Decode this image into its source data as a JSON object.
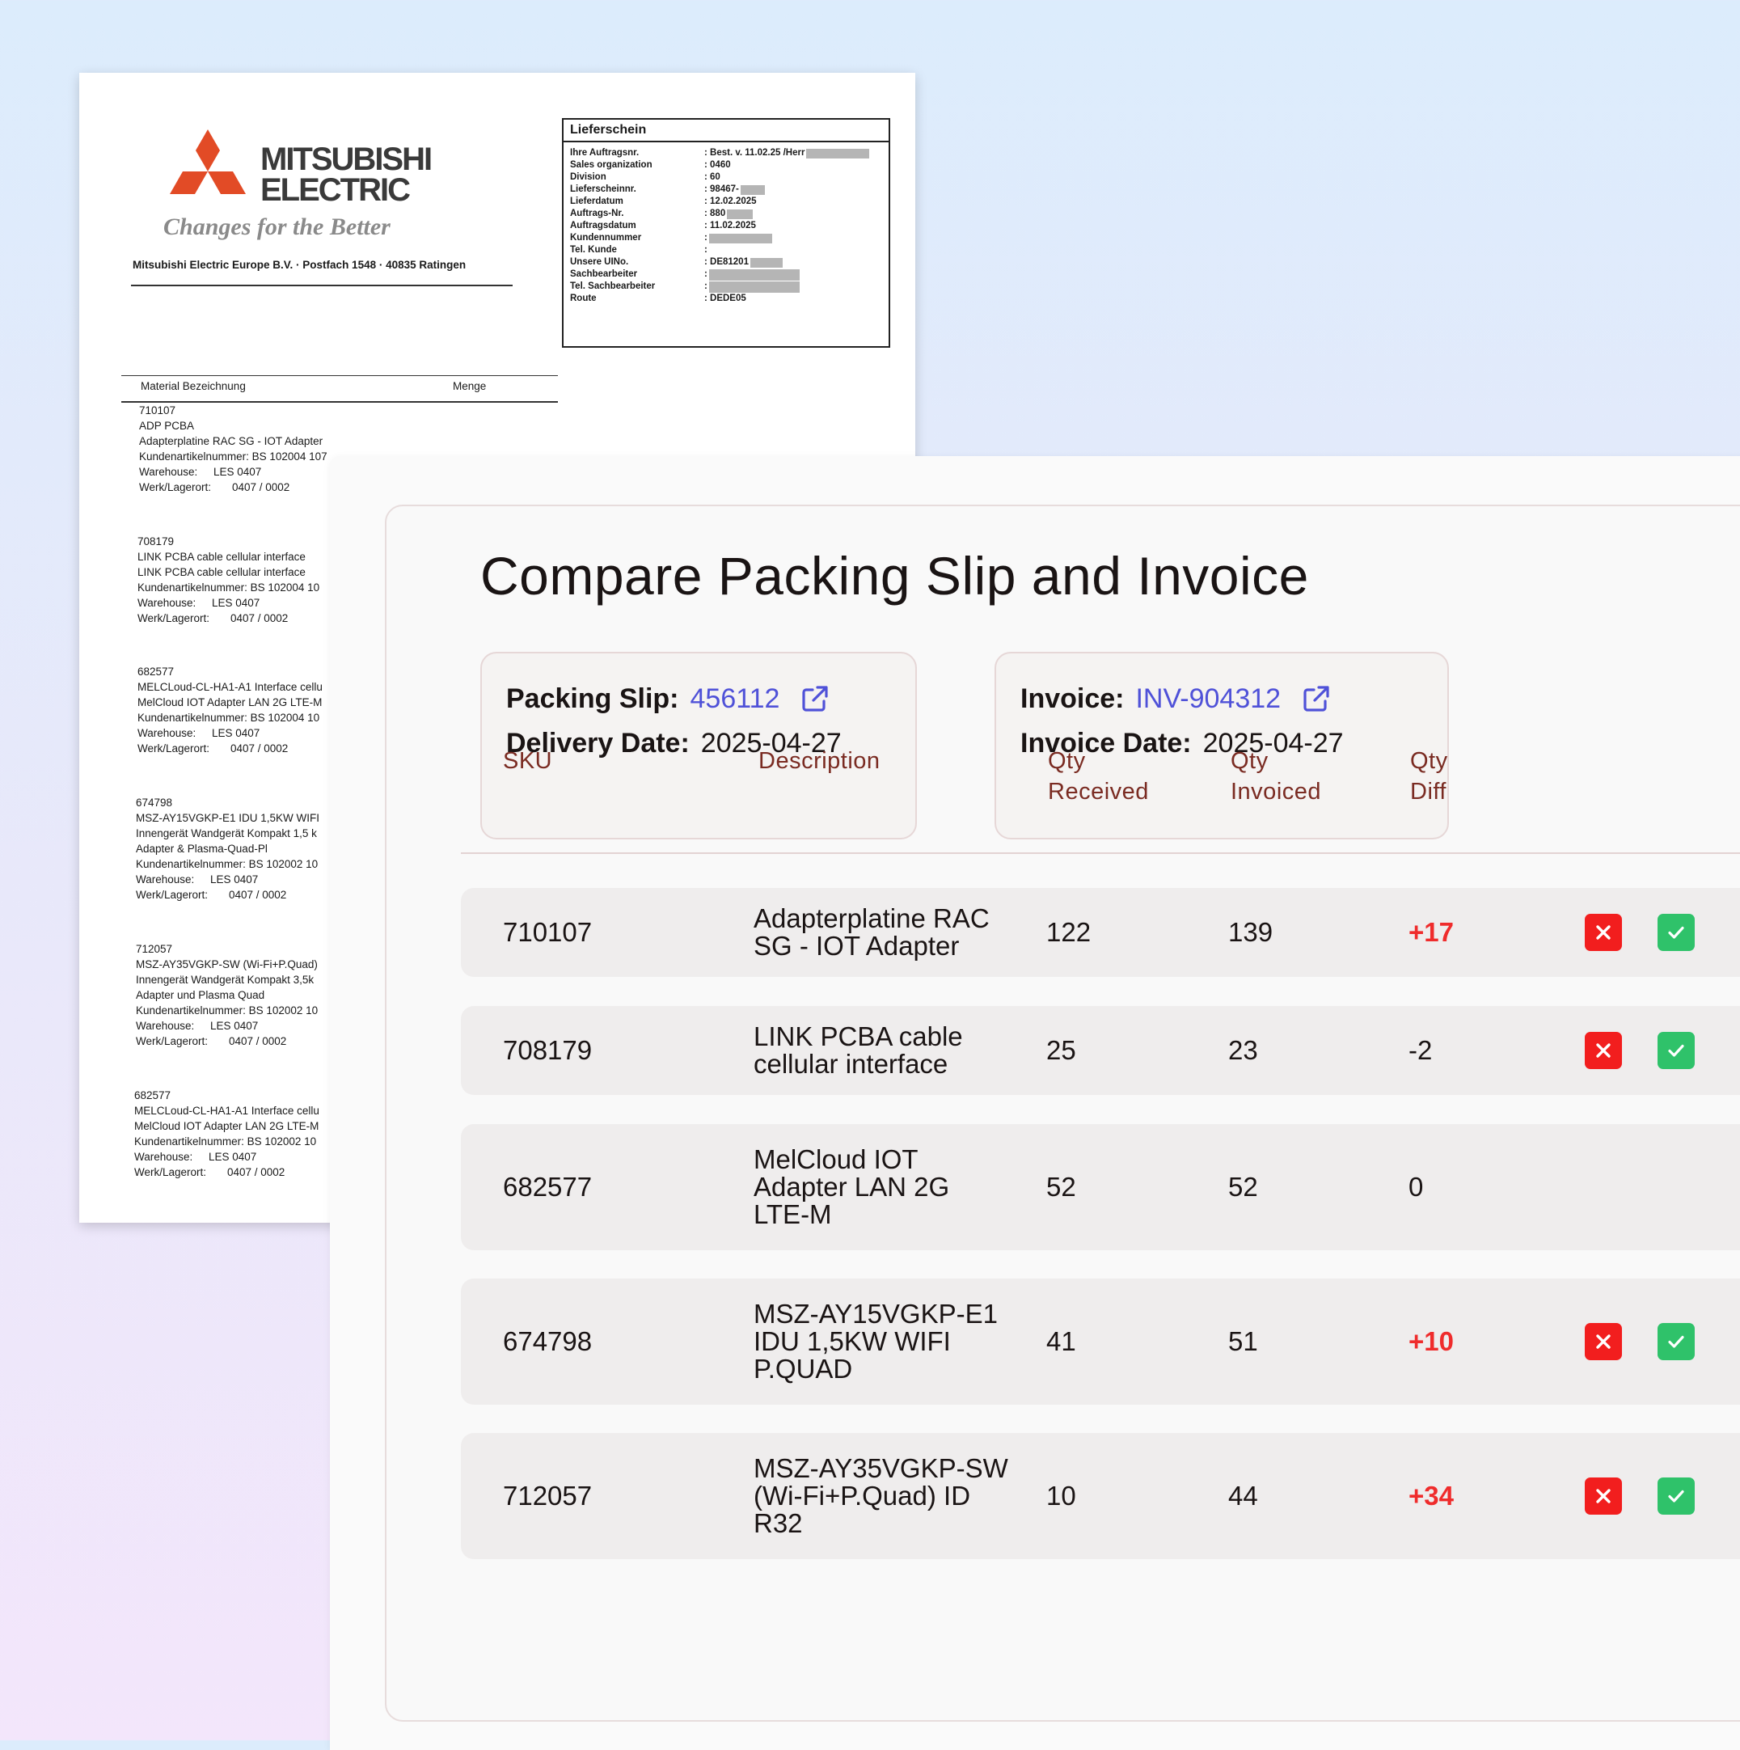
{
  "delivery_note": {
    "brand_name_line1": "MITSUBISHI",
    "brand_name_line2": "ELECTRIC",
    "tagline": "Changes for the Better",
    "sender": "Mitsubishi Electric Europe B.V. · Postfach 1548 · 40835 Ratingen",
    "box_title": "Lieferschein",
    "fields": [
      {
        "label": "Ihre Auftragsnr.",
        "value": ": Best. v. 11.02.25 /Herr"
      },
      {
        "label": "Sales organization",
        "value": ": 0460"
      },
      {
        "label": "Division",
        "value": ": 60"
      },
      {
        "label": "Lieferscheinnr.",
        "value": ": 98467-"
      },
      {
        "label": "Lieferdatum",
        "value": ": 12.02.2025"
      },
      {
        "label": "Auftrags-Nr.",
        "value": ": 880"
      },
      {
        "label": "Auftragsdatum",
        "value": ": 11.02.2025"
      },
      {
        "label": "Kundennummer",
        "value": ":"
      },
      {
        "label": "Tel. Kunde",
        "value": ":"
      },
      {
        "label": "Unsere UINo.",
        "value": ": DE81201"
      },
      {
        "label": "Sachbearbeiter",
        "value": ":"
      },
      {
        "label": "Tel. Sachbearbeiter",
        "value": ":"
      },
      {
        "label": "Route",
        "value": ": DEDE05"
      }
    ],
    "col_material": "Material Bezeichnung",
    "col_quantity": "Menge",
    "warehouse_label": "Warehouse:",
    "werk_label": "Werk/Lagerort:",
    "items": [
      {
        "number": "710107",
        "line1": "ADP PCBA",
        "line2": "Adapterplatine RAC SG - IOT Adapter",
        "customer_no": "Kundenartikelnummer: BS 102004 107",
        "warehouse": "LES 0407",
        "werk": "0407 / 0002"
      },
      {
        "number": "708179",
        "line1": "LINK PCBA cable cellular interface",
        "line2": "LINK PCBA cable cellular interface",
        "customer_no": "Kundenartikelnummer: BS 102004 10",
        "warehouse": "LES 0407",
        "werk": "0407 / 0002"
      },
      {
        "number": "682577",
        "line1": "MELCLoud-CL-HA1-A1 Interface cellu",
        "line2": "MelCloud IOT Adapter LAN 2G LTE-M",
        "customer_no": "Kundenartikelnummer: BS 102004 10",
        "warehouse": "LES 0407",
        "werk": "0407 / 0002"
      },
      {
        "number": "674798",
        "line1": "MSZ-AY15VGKP-E1 IDU 1,5KW WIFI",
        "line2": "Innengerät Wandgerät Kompakt 1,5 k",
        "line3": "Adapter & Plasma-Quad-Pl",
        "customer_no": "Kundenartikelnummer: BS 102002 10",
        "warehouse": "LES 0407",
        "werk": "0407 / 0002"
      },
      {
        "number": "712057",
        "line1": "MSZ-AY35VGKP-SW (Wi-Fi+P.Quad)",
        "line2": "Innengerät Wandgerät Kompakt 3,5k",
        "line3": "Adapter und Plasma Quad",
        "customer_no": "Kundenartikelnummer: BS 102002 10",
        "warehouse": "LES 0407",
        "werk": "0407 / 0002"
      },
      {
        "number": "682577",
        "line1": "MELCLoud-CL-HA1-A1 Interface cellu",
        "line2": "MelCloud IOT Adapter LAN 2G LTE-M",
        "customer_no": "Kundenartikelnummer: BS 102002 10",
        "warehouse": "LES 0407",
        "werk": "0407 / 0002"
      }
    ]
  },
  "compare": {
    "title": "Compare Packing Slip and Invoice",
    "packing_slip": {
      "label": "Packing Slip:",
      "number": "456112",
      "date_label": "Delivery Date:",
      "date": "2025-04-27"
    },
    "invoice": {
      "label": "Invoice:",
      "number": "INV-904312",
      "date_label": "Invoice Date:",
      "date": "2025-04-27"
    },
    "columns": {
      "sku": "SKU",
      "description": "Description",
      "qty_received_1": "Qty",
      "qty_received_2": "Received",
      "qty_invoiced_1": "Qty",
      "qty_invoiced_2": "Invoiced",
      "qty_diff_1": "Qty",
      "qty_diff_2": "Diff"
    },
    "rows": [
      {
        "sku": "710107",
        "description": "Adapterplatine RAC SG - IOT Adapter",
        "qty_received": "122",
        "qty_invoiced": "139",
        "qty_diff": "+17",
        "has_actions": true
      },
      {
        "sku": "708179",
        "description": "LINK PCBA cable cellular interface",
        "qty_received": "25",
        "qty_invoiced": "23",
        "qty_diff": "-2",
        "has_actions": true
      },
      {
        "sku": "682577",
        "description": "MelCloud IOT Adapter LAN 2G LTE-M",
        "qty_received": "52",
        "qty_invoiced": "52",
        "qty_diff": "0",
        "has_actions": false
      },
      {
        "sku": "674798",
        "description": "MSZ-AY15VGKP-E1 IDU 1,5KW WIFI P.QUAD",
        "qty_received": "41",
        "qty_invoiced": "51",
        "qty_diff": "+10",
        "has_actions": true
      },
      {
        "sku": "712057",
        "description": "MSZ-AY35VGKP-SW (Wi-Fi+P.Quad) ID R32",
        "qty_received": "10",
        "qty_invoiced": "44",
        "qty_diff": "+34",
        "has_actions": true
      }
    ],
    "colors": {
      "link": "#4f51d8",
      "header_text": "#7a2b22",
      "diff_positive": "#ef2c2c",
      "reject": "#f21e1e",
      "accept": "#2fc26a"
    },
    "icons": {
      "link_icon": "external-link-icon",
      "reject_icon": "x-icon",
      "accept_icon": "check-icon"
    }
  }
}
